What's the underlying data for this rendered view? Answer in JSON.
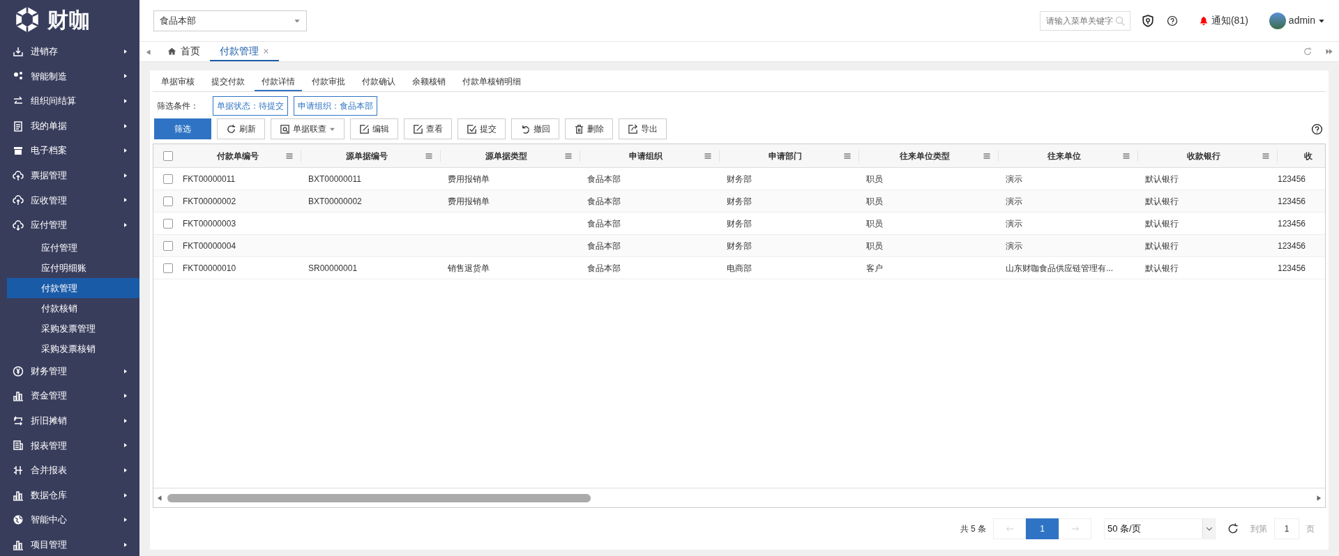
{
  "brand": {
    "name": "财咖"
  },
  "sidebar": {
    "items": [
      {
        "label": "进销存"
      },
      {
        "label": "智能制造"
      },
      {
        "label": "组织间结算"
      },
      {
        "label": "我的单据"
      },
      {
        "label": "电子档案"
      },
      {
        "label": "票据管理"
      },
      {
        "label": "应收管理"
      },
      {
        "label": "应付管理",
        "children": [
          {
            "label": "应付管理",
            "selected": false
          },
          {
            "label": "应付明细账",
            "selected": false
          },
          {
            "label": "付款管理",
            "selected": true
          },
          {
            "label": "付款核销",
            "selected": false
          },
          {
            "label": "采购发票管理",
            "selected": false
          },
          {
            "label": "采购发票核销",
            "selected": false
          }
        ]
      },
      {
        "label": "财务管理"
      },
      {
        "label": "资金管理"
      },
      {
        "label": "折旧摊销"
      },
      {
        "label": "报表管理"
      },
      {
        "label": "合并报表"
      },
      {
        "label": "数据仓库"
      },
      {
        "label": "智能中心"
      },
      {
        "label": "项目管理"
      }
    ]
  },
  "header": {
    "org_select": "食品本部",
    "search": {
      "placeholder": "请输入菜单关键字"
    },
    "notifications": "通知(81)",
    "user": "admin"
  },
  "page_tabs": [
    {
      "label": "首页",
      "kind": "home",
      "selected": false
    },
    {
      "label": "付款管理",
      "kind": "closable",
      "selected": true
    }
  ],
  "sub_tabs": [
    {
      "label": "单据审核",
      "selected": false
    },
    {
      "label": "提交付款",
      "selected": false
    },
    {
      "label": "付款详情",
      "selected": true
    },
    {
      "label": "付款审批",
      "selected": false
    },
    {
      "label": "付款确认",
      "selected": false
    },
    {
      "label": "余额核销",
      "selected": false
    },
    {
      "label": "付款单核销明细",
      "selected": false
    }
  ],
  "filters": {
    "label": "筛选条件：",
    "chips": [
      "单据状态：待提交",
      "申请组织：食品本部"
    ]
  },
  "toolbar": [
    {
      "label": "筛选",
      "kind": "primary"
    },
    {
      "label": "刷新",
      "kind": "refresh"
    },
    {
      "label": "单据联查",
      "kind": "dropdown"
    },
    {
      "label": "编辑",
      "kind": "edit"
    },
    {
      "label": "查看",
      "kind": "edit"
    },
    {
      "label": "提交",
      "kind": "check"
    },
    {
      "label": "撤回",
      "kind": "undo"
    },
    {
      "label": "删除",
      "kind": "trash"
    },
    {
      "label": "导出",
      "kind": "export"
    }
  ],
  "table": {
    "all_checked": false,
    "columns": [
      "付款单编号",
      "源单据编号",
      "源单据类型",
      "申请组织",
      "申请部门",
      "往来单位类型",
      "往来单位",
      "收款银行",
      "收"
    ],
    "rows": [
      {
        "checked": false,
        "cells": [
          "FKT00000011",
          "BXT00000011",
          "费用报销单",
          "食品本部",
          "财务部",
          "职员",
          "演示",
          "默认银行",
          "123456"
        ]
      },
      {
        "checked": false,
        "cells": [
          "FKT00000002",
          "BXT00000002",
          "费用报销单",
          "食品本部",
          "财务部",
          "职员",
          "演示",
          "默认银行",
          "123456"
        ]
      },
      {
        "checked": false,
        "cells": [
          "FKT00000003",
          "",
          "",
          "食品本部",
          "财务部",
          "职员",
          "演示",
          "默认银行",
          "123456"
        ]
      },
      {
        "checked": false,
        "cells": [
          "FKT00000004",
          "",
          "",
          "食品本部",
          "财务部",
          "职员",
          "演示",
          "默认银行",
          "123456"
        ]
      },
      {
        "checked": false,
        "cells": [
          "FKT00000010",
          "SR00000001",
          "销售退货单",
          "食品本部",
          "电商部",
          "客户",
          "山东财咖食品供应链管理有...",
          "默认银行",
          "123456"
        ]
      }
    ]
  },
  "pagination": {
    "total": "共 5 条",
    "current_page": "1",
    "page_size": "50 条/页",
    "goto_label": "到第",
    "goto_value": "1",
    "page_suffix": "页"
  }
}
